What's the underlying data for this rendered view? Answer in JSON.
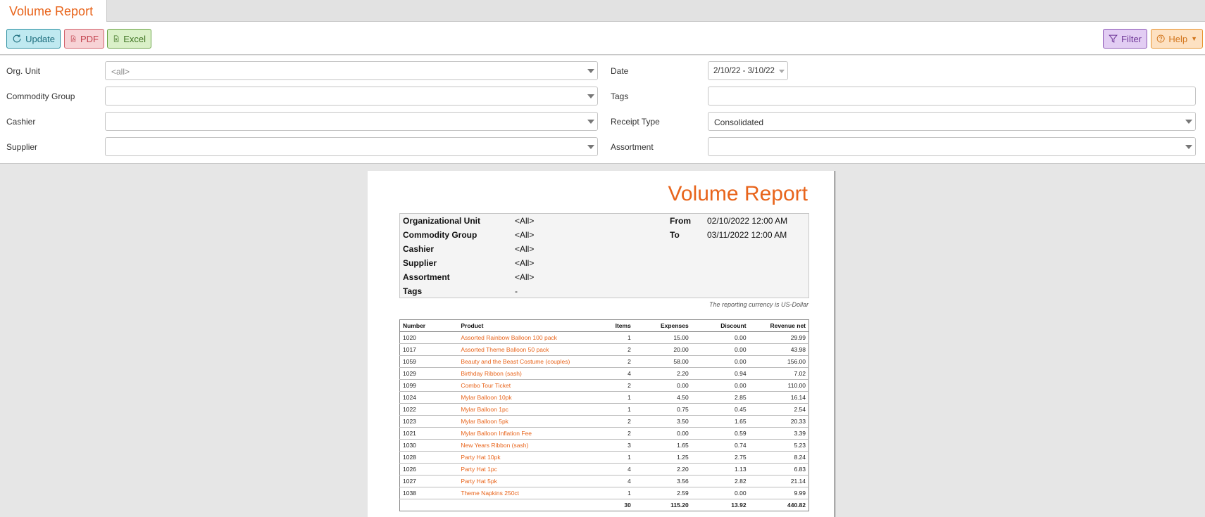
{
  "tab": {
    "title": "Volume Report"
  },
  "toolbar": {
    "update": "Update",
    "pdf": "PDF",
    "excel": "Excel",
    "filter": "Filter",
    "help": "Help"
  },
  "filters": {
    "org_unit": {
      "label": "Org. Unit",
      "value": "<all>"
    },
    "commodity_group": {
      "label": "Commodity Group",
      "value": ""
    },
    "cashier": {
      "label": "Cashier",
      "value": ""
    },
    "supplier": {
      "label": "Supplier",
      "value": ""
    },
    "date": {
      "label": "Date",
      "value": "2/10/22 - 3/10/22"
    },
    "tags": {
      "label": "Tags",
      "value": ""
    },
    "receipt_type": {
      "label": "Receipt Type",
      "value": "Consolidated"
    },
    "assortment": {
      "label": "Assortment",
      "value": ""
    }
  },
  "report": {
    "title": "Volume Report",
    "info": {
      "org_unit": {
        "label": "Organizational Unit",
        "value": "<All>"
      },
      "commodity_group": {
        "label": "Commodity Group",
        "value": "<All>"
      },
      "cashier": {
        "label": "Cashier",
        "value": "<All>"
      },
      "supplier": {
        "label": "Supplier",
        "value": "<All>"
      },
      "assortment": {
        "label": "Assortment",
        "value": "<All>"
      },
      "tags": {
        "label": "Tags",
        "value": "-"
      },
      "from": {
        "label": "From",
        "value": "02/10/2022 12:00 AM"
      },
      "to": {
        "label": "To",
        "value": "03/11/2022 12:00 AM"
      }
    },
    "currency_note": "The reporting currency is US-Dollar",
    "columns": [
      "Number",
      "Product",
      "Items",
      "Expenses",
      "Discount",
      "Revenue net"
    ],
    "rows": [
      [
        "1020",
        "Assorted Rainbow Balloon 100 pack",
        "1",
        "15.00",
        "0.00",
        "29.99"
      ],
      [
        "1017",
        "Assorted Theme Balloon 50 pack",
        "2",
        "20.00",
        "0.00",
        "43.98"
      ],
      [
        "1059",
        "Beauty and the Beast Costume (couples)",
        "2",
        "58.00",
        "0.00",
        "156.00"
      ],
      [
        "1029",
        "Birthday Ribbon (sash)",
        "4",
        "2.20",
        "0.94",
        "7.02"
      ],
      [
        "1099",
        "Combo Tour Ticket",
        "2",
        "0.00",
        "0.00",
        "110.00"
      ],
      [
        "1024",
        "Mylar Balloon 10pk",
        "1",
        "4.50",
        "2.85",
        "16.14"
      ],
      [
        "1022",
        "Mylar Balloon 1pc",
        "1",
        "0.75",
        "0.45",
        "2.54"
      ],
      [
        "1023",
        "Mylar Balloon 5pk",
        "2",
        "3.50",
        "1.65",
        "20.33"
      ],
      [
        "1021",
        "Mylar Balloon Inflation Fee",
        "2",
        "0.00",
        "0.59",
        "3.39"
      ],
      [
        "1030",
        "New Years Ribbon (sash)",
        "3",
        "1.65",
        "0.74",
        "5.23"
      ],
      [
        "1028",
        "Party Hat 10pk",
        "1",
        "1.25",
        "2.75",
        "8.24"
      ],
      [
        "1026",
        "Party Hat 1pc",
        "4",
        "2.20",
        "1.13",
        "6.83"
      ],
      [
        "1027",
        "Party Hat 5pk",
        "4",
        "3.56",
        "2.82",
        "21.14"
      ],
      [
        "1038",
        "Theme Napkins 250ct",
        "1",
        "2.59",
        "0.00",
        "9.99"
      ]
    ],
    "totals": [
      "",
      "",
      "30",
      "115.20",
      "13.92",
      "440.82"
    ]
  }
}
